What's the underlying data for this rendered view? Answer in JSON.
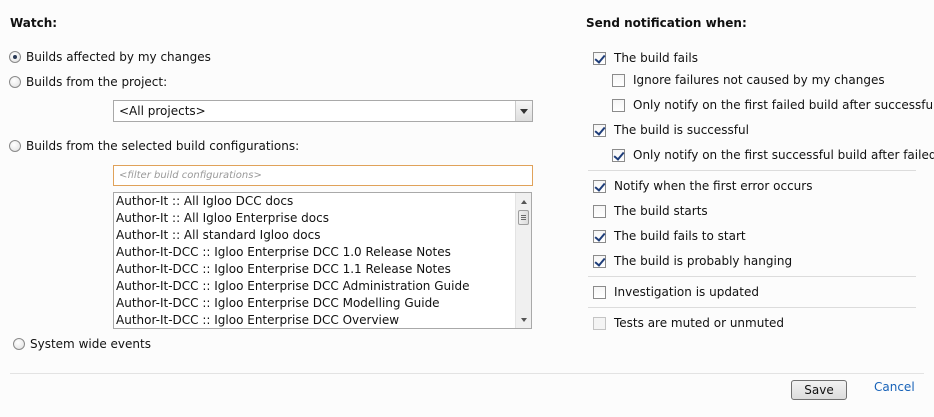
{
  "watch": {
    "heading": "Watch:",
    "options": {
      "my_changes": "Builds affected by my changes",
      "project": "Builds from the project:",
      "configurations": "Builds from the selected build configurations:",
      "system": "System wide events"
    },
    "selected_option": "my_changes",
    "project_select": {
      "value": "<All projects>"
    },
    "filter_input": {
      "placeholder": "<filter build configurations>",
      "value": ""
    },
    "configurations_list": [
      "Author-It :: All Igloo DCC docs",
      "Author-It :: All Igloo Enterprise docs",
      "Author-It :: All standard Igloo docs",
      "Author-It-DCC :: Igloo Enterprise DCC 1.0 Release Notes",
      "Author-It-DCC :: Igloo Enterprise DCC 1.1 Release Notes",
      "Author-It-DCC :: Igloo Enterprise DCC Administration Guide",
      "Author-It-DCC :: Igloo Enterprise DCC Modelling Guide",
      "Author-It-DCC :: Igloo Enterprise DCC Overview"
    ]
  },
  "notify": {
    "heading": "Send notification when:",
    "options": {
      "build_fails": {
        "label": "The build fails",
        "checked": true
      },
      "ignore_failures": {
        "label": "Ignore failures not caused by my changes",
        "checked": false
      },
      "first_failed": {
        "label": "Only notify on the first failed build after successful",
        "checked": false
      },
      "build_successful": {
        "label": "The build is successful",
        "checked": true
      },
      "first_successful": {
        "label": "Only notify on the first successful build after failed",
        "checked": true
      },
      "first_error": {
        "label": "Notify when the first error occurs",
        "checked": true
      },
      "build_starts": {
        "label": "The build starts",
        "checked": false
      },
      "fails_to_start": {
        "label": "The build fails to start",
        "checked": true
      },
      "hanging": {
        "label": "The build is probably hanging",
        "checked": true
      },
      "investigation": {
        "label": "Investigation is updated",
        "checked": false
      },
      "tests_muted": {
        "label": "Tests are muted or unmuted",
        "checked": false,
        "disabled": true
      }
    }
  },
  "actions": {
    "save": "Save",
    "cancel": "Cancel"
  }
}
